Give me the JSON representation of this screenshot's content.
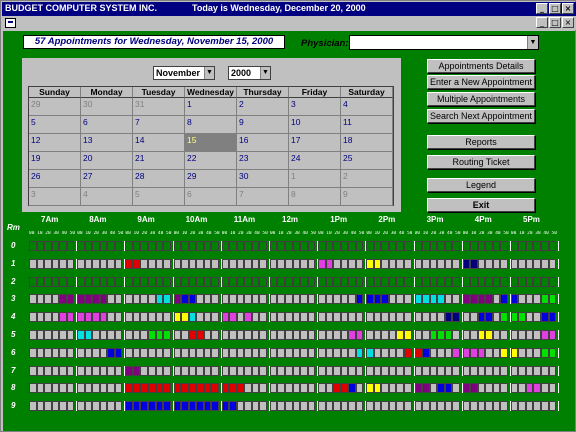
{
  "titlebar": {
    "app": "BUDGET COMPUTER SYSTEM INC.",
    "today": "Today is Wednesday, December 20, 2000"
  },
  "window_buttons": [
    "_",
    "□",
    "×"
  ],
  "header": {
    "appointments_text": "57 Appointments for Wednesday, November 15, 2000",
    "physician_label": "Physician:",
    "physician_value": ""
  },
  "calendar": {
    "month": "November",
    "year": "2000",
    "days": [
      "Sunday",
      "Monday",
      "Tuesday",
      "Wednesday",
      "Thursday",
      "Friday",
      "Saturday"
    ],
    "weeks": [
      [
        "29",
        "30",
        "31",
        "1",
        "2",
        "3",
        "4"
      ],
      [
        "5",
        "6",
        "7",
        "8",
        "9",
        "10",
        "11"
      ],
      [
        "12",
        "13",
        "14",
        "15",
        "16",
        "17",
        "18"
      ],
      [
        "19",
        "20",
        "21",
        "22",
        "23",
        "24",
        "25"
      ],
      [
        "26",
        "27",
        "28",
        "29",
        "30",
        "1",
        "2"
      ],
      [
        "3",
        "4",
        "5",
        "6",
        "7",
        "8",
        "9"
      ]
    ],
    "selected": "15"
  },
  "buttons": [
    "Appointments Details",
    "Enter a New Appointment",
    "Multiple Appointments",
    "Search Next Appointment",
    "Reports",
    "Routing Ticket",
    "Legend",
    "Exit"
  ],
  "hours": [
    "7Am",
    "8Am",
    "9Am",
    "10Am",
    "11Am",
    "12m",
    "1Pm",
    "2Pm",
    "3Pm",
    "4Pm",
    "5Pm"
  ],
  "rm_label": "Rm",
  "minutes_label": "00 10 20 30 40 50",
  "rooms": [
    "0",
    "1",
    "2",
    "3",
    "4",
    "5",
    "6",
    "7",
    "8",
    "9"
  ],
  "colors": {
    "empty": "#c0c0c0",
    "free": "#008000",
    "red": "#e00000",
    "magenta": "#e040e0",
    "yellow": "#ffff00",
    "blue": "#0000e0",
    "cyan": "#00e0e0",
    "lime": "#00e000",
    "purple": "#800080",
    "navy": "#000080",
    "maroon": "#800000"
  },
  "schedule": [
    "GGGGGGGGGGGGGGGGGGGGGGGGGGGGGGGGGGGGGGGGGGGGGGGGGGGGGGGGGGGGGGGGGG",
    "eeeeeeeeeeeeRReeeeeeeeeeeeeeeeeeeeeeMMeeeeYYeeeeeeeeeeNNeeeeeeeeee",
    "GGGGGGGGGGGGGGGGGGGGGGGGGGGGGGGGGGGGGGGGGGGGGGGGGGGGGGGGGGGGGGGGGG",
    "eeeePPPPPPeeeeeeCCPBBeeeeeeeeeeeeeeeeeeeeBBBBeeeCCCCeePPPPeBBeeeLL",
    "eeeeMMMMMMeeeeeeeeYYCeeeMMeMeeeeeeeeeeeeeeeeeeeeeeeeNNeeBBeLLLeeBB",
    "eeeeeeCCeeeeeeeLLLeeRReeeeeeeeeeeeeeeeeeMMeeeeYYeeLLLeeeYYeeeeeeMM",
    "eeeeeeeeeeBBeeeeeeeeeeeeeeeeeeeeeeeeeeeeeCCeeeeRRBeeeMMMMeeYYeeeLL",
    "eeeeeeeeeeeePPeeeeeeeeeeeeeeeeeeeeeeeeeeeeeeeeeeeeeeeeeeeeeeeeeeee",
    "eeeeeeeeeeeeRRRRRRRRRRRRRRReeeeeeeeeeeRRBeYYeeeePPeBBePPeeeeeeMMee",
    "eeeeeeeeeeeeBBBBBBBBBBBBBBeeeeeeeeeeeeeeeeeeeeeeeeeeeeeeeeeeeeeeee"
  ]
}
